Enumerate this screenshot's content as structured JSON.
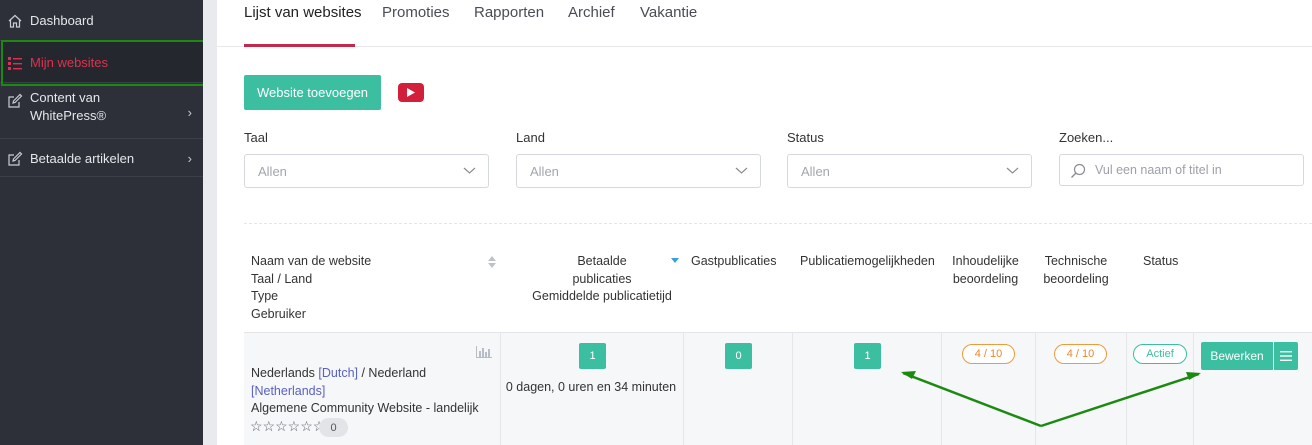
{
  "sidebar": {
    "items": [
      {
        "label": "Dashboard",
        "icon": "home-icon"
      },
      {
        "label": "Mijn websites",
        "icon": "list-icon"
      },
      {
        "label_line1": "Content van",
        "label_line2": "WhitePress®",
        "icon": "edit-icon"
      },
      {
        "label": "Betaalde artikelen",
        "icon": "edit-icon"
      }
    ]
  },
  "tabs": [
    "Lijst van websites",
    "Promoties",
    "Rapporten",
    "Archief",
    "Vakantie"
  ],
  "toolbar": {
    "add_label": "Website toevoegen",
    "video_icon": "youtube-icon"
  },
  "filters": {
    "language": {
      "label": "Taal",
      "value": "Allen"
    },
    "country": {
      "label": "Land",
      "value": "Allen"
    },
    "status": {
      "label": "Status",
      "value": "Allen"
    },
    "search": {
      "label": "Zoeken...",
      "placeholder": "Vul een naam of titel in"
    }
  },
  "table": {
    "headers": {
      "website": [
        "Naam van de website",
        "Taal / Land",
        "Type",
        "Gebruiker"
      ],
      "paid": [
        "Betaalde",
        "publicaties",
        "Gemiddelde publicatietijd"
      ],
      "guest": "Gastpublicaties",
      "options": "Publicatiemogelijkheden",
      "content_review": [
        "Inhoudelijke",
        "beoordeling"
      ],
      "tech_review": [
        "Technische",
        "beoordeling"
      ],
      "status": "Status"
    },
    "row": {
      "lang_prefix": "Nederlands ",
      "lang_code": "[Dutch]",
      "country_sep": " / Nederland",
      "country_code": "[Netherlands]",
      "type": "Algemene Community Website - landelijk",
      "stars": "☆☆☆☆☆☆",
      "rating_count": "0",
      "paid_count": "1",
      "avg_time": "0 dagen, 0 uren en 34 minuten",
      "guest_count": "0",
      "options_count": "1",
      "content_review": "4 / 10",
      "tech_review": "4 / 10",
      "status": "Actief",
      "edit_label": "Bewerken"
    }
  },
  "colors": {
    "accent": "#3cbfa0",
    "active_nav": "#e0304f",
    "annotation": "#1c8a10"
  }
}
